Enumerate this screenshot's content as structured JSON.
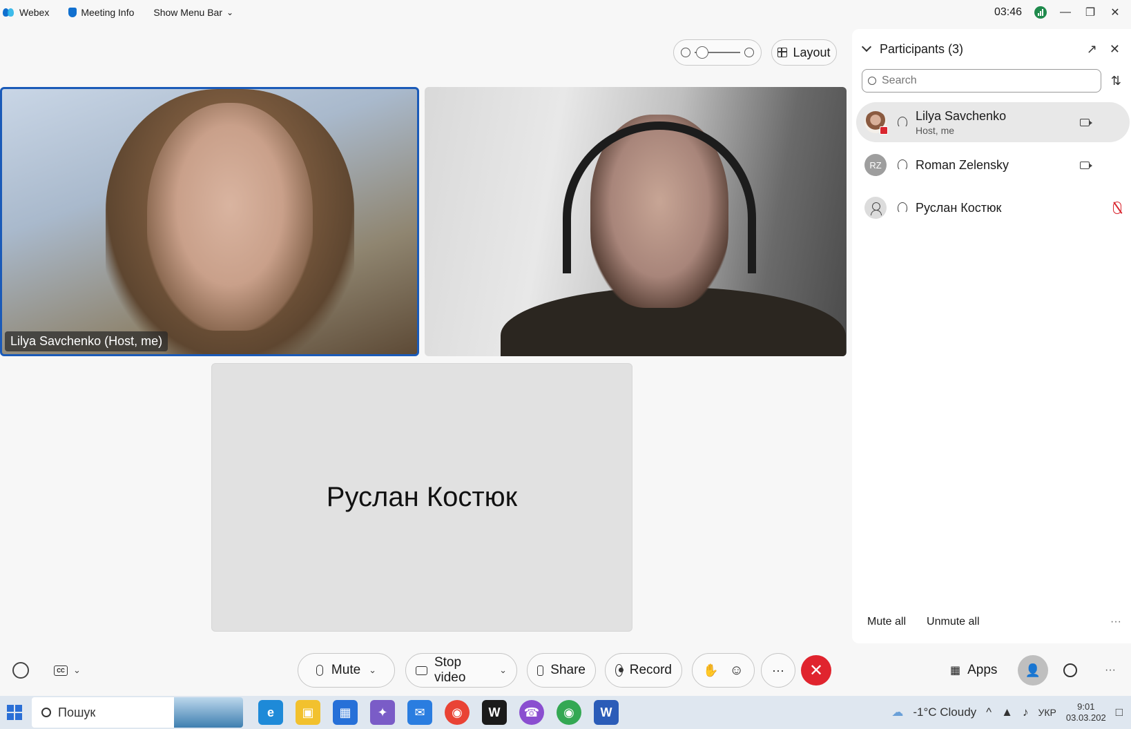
{
  "topbar": {
    "app_name": "Webex",
    "meeting_info": "Meeting Info",
    "show_menu_bar": "Show Menu Bar",
    "time": "03:46"
  },
  "view": {
    "layout_label": "Layout"
  },
  "tiles": {
    "tile1_name": "Lilya Savchenko (Host, me)",
    "tile3_name": "Руслан Костюк"
  },
  "participants": {
    "title": "Participants (3)",
    "search_placeholder": "Search",
    "list": [
      {
        "name": "Lilya Savchenko",
        "sub": "Host, me"
      },
      {
        "name": "Roman Zelensky",
        "initials": "RZ"
      },
      {
        "name": "Руслан Костюк"
      }
    ],
    "mute_all": "Mute all",
    "unmute_all": "Unmute all"
  },
  "controls": {
    "mute": "Mute",
    "stop_video": "Stop video",
    "share": "Share",
    "record": "Record",
    "apps": "Apps"
  },
  "taskbar": {
    "search_text": "Пошук",
    "weather": "-1°C  Cloudy",
    "lang": "УКР",
    "clock_time": "9:01",
    "clock_date": "03.03.202"
  },
  "colors": {
    "accent": "#1170cf",
    "end_call": "#e0242e",
    "active_border": "#1a5ab8"
  }
}
